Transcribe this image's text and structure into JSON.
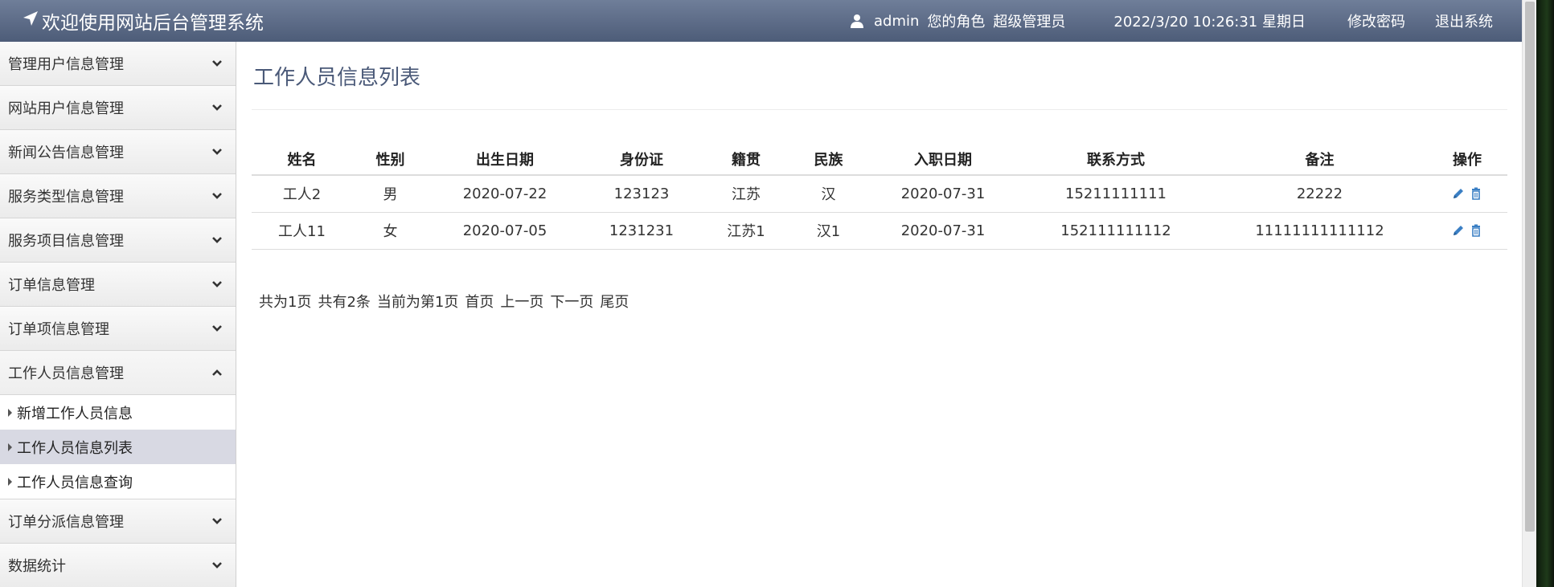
{
  "header": {
    "title": "欢迎使用网站后台管理系统",
    "username": "admin",
    "role_label": "您的角色",
    "role_value": "超级管理员",
    "datetime": "2022/3/20 10:26:31 星期日",
    "change_password": "修改密码",
    "logout": "退出系统",
    "icons": [
      "send-icon",
      "user-icon"
    ]
  },
  "sidebar": {
    "items": [
      {
        "label": "管理用户信息管理",
        "icon": "chevron-down-icon"
      },
      {
        "label": "网站用户信息管理",
        "icon": "chevron-down-icon"
      },
      {
        "label": "新闻公告信息管理",
        "icon": "chevron-down-icon"
      },
      {
        "label": "服务类型信息管理",
        "icon": "chevron-down-icon"
      },
      {
        "label": "服务项目信息管理",
        "icon": "chevron-down-icon"
      },
      {
        "label": "订单信息管理",
        "icon": "chevron-down-icon"
      },
      {
        "label": "订单项信息管理",
        "icon": "chevron-down-icon"
      },
      {
        "label": "工作人员信息管理",
        "icon": "chevron-up-icon"
      },
      {
        "label": "订单分派信息管理",
        "icon": "chevron-down-icon"
      },
      {
        "label": "数据统计",
        "icon": "chevron-down-icon"
      }
    ],
    "sub_items": [
      {
        "label": "新增工作人员信息"
      },
      {
        "label": "工作人员信息列表"
      },
      {
        "label": "工作人员信息查询"
      }
    ]
  },
  "main": {
    "title": "工作人员信息列表",
    "table": {
      "headers": [
        "姓名",
        "性别",
        "出生日期",
        "身份证",
        "籍贯",
        "民族",
        "入职日期",
        "联系方式",
        "备注",
        "操作"
      ],
      "rows": [
        [
          "工人2",
          "男",
          "2020-07-22",
          "123123",
          "江苏",
          "汉",
          "2020-07-31",
          "15211111111",
          "22222"
        ],
        [
          "工人11",
          "女",
          "2020-07-05",
          "1231231",
          "江苏1",
          "汉1",
          "2020-07-31",
          "152111111112",
          "11111111111112"
        ]
      ],
      "row_icons": [
        "edit-icon",
        "trash-icon"
      ]
    },
    "pager": {
      "total_pages": "共为1页",
      "total_items": "共有2条",
      "current": "当前为第1页",
      "first": "首页",
      "prev": "上一页",
      "next": "下一页",
      "last": "尾页"
    }
  },
  "colors": {
    "header_top": "#6f7e99",
    "header_bottom": "#4d5c78",
    "title": "#4a5978",
    "icon_blue": "#3a7fc4",
    "active_sub": "#d8d9e3"
  }
}
